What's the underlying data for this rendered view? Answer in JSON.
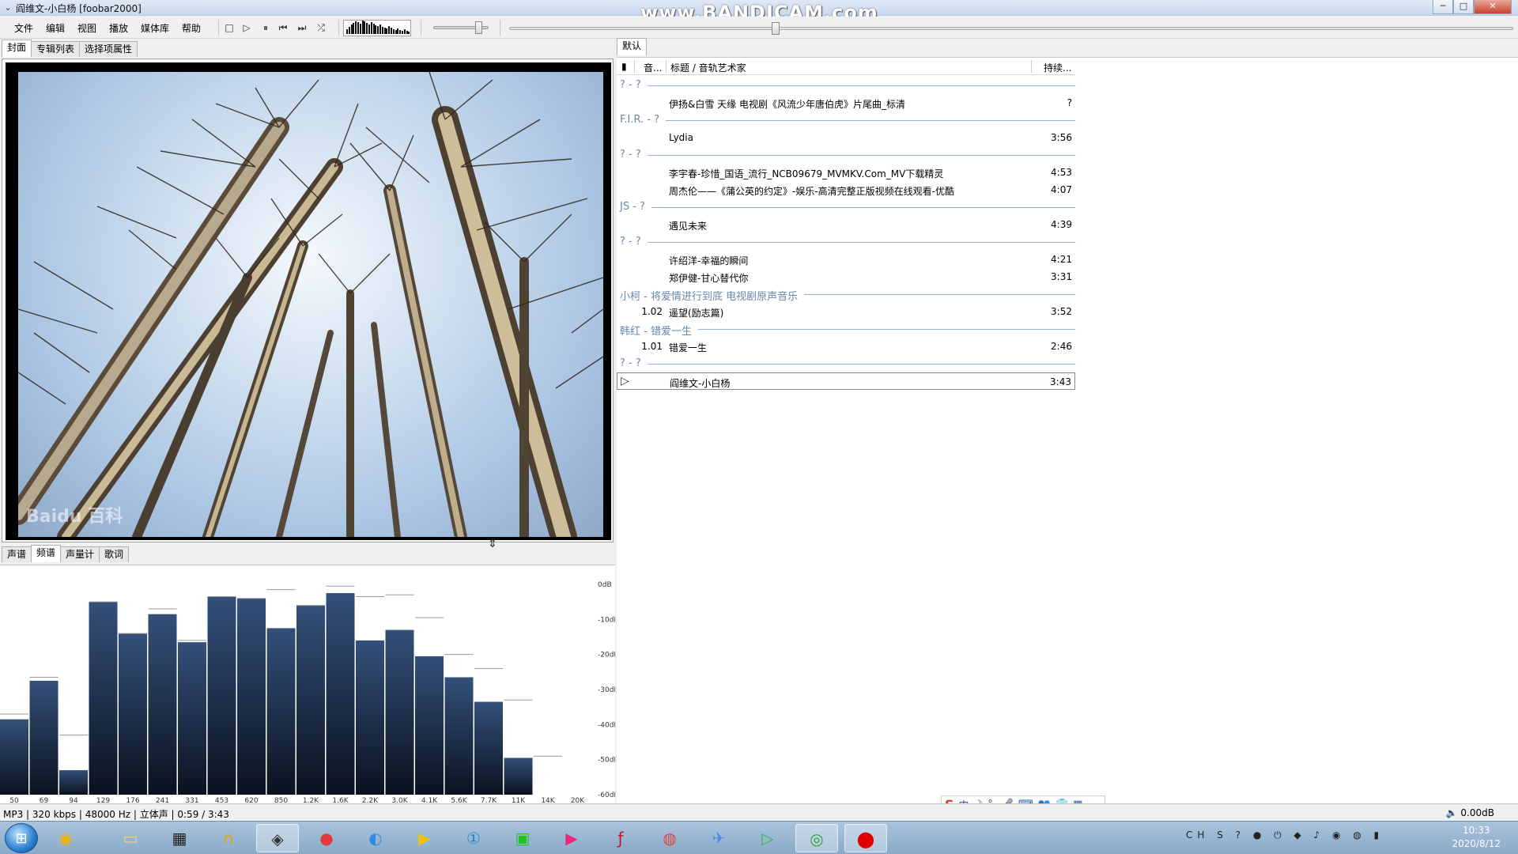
{
  "window": {
    "title": "阎维文-小白杨  [foobar2000]",
    "watermark": "www.BANDICAM.com",
    "minimize_label": "─",
    "maximize_label": "□",
    "close_label": "✕"
  },
  "menu": {
    "items": [
      "文件",
      "编辑",
      "视图",
      "播放",
      "媒体库",
      "帮助"
    ]
  },
  "toolbar": {
    "stop_icon": "stop-icon",
    "play_icon": "play-icon",
    "pause_icon": "pause-icon",
    "prev_icon": "previous-icon",
    "next_icon": "next-icon",
    "random_icon": "random-icon",
    "volume_level": 0.82,
    "seek_position": 0.265
  },
  "left_tabs": [
    {
      "label": "封面",
      "active": true
    },
    {
      "label": "专辑列表",
      "active": false
    },
    {
      "label": "选择项属性",
      "active": false
    }
  ],
  "cover": {
    "watermark": "Baidu 百科"
  },
  "bottom_tabs": [
    {
      "label": "声谱",
      "active": false
    },
    {
      "label": "频谱",
      "active": true
    },
    {
      "label": "声量计",
      "active": false
    },
    {
      "label": "歌词",
      "active": false
    }
  ],
  "chart_data": {
    "type": "bar",
    "categories": [
      "50",
      "69",
      "94",
      "129",
      "176",
      "241",
      "331",
      "453",
      "620",
      "850",
      "1.2K",
      "1.6K",
      "2.2K",
      "3.0K",
      "4.1K",
      "5.6K",
      "7.7K",
      "11K",
      "14K",
      "20K"
    ],
    "values": [
      -38.5,
      -27.5,
      -53,
      -5,
      -14,
      -8.5,
      -16.5,
      -3.5,
      -4,
      -12.5,
      -6,
      -2.5,
      -16,
      -13,
      -20.5,
      -26.5,
      -33.5,
      -49.5,
      -60,
      -60
    ],
    "peaks": [
      -37,
      -26.5,
      -43,
      -5,
      -14,
      -7,
      -16,
      -3.5,
      -4,
      -1.5,
      -6,
      -0.5,
      -3.5,
      -3,
      -9.5,
      -20,
      -24,
      -33,
      -49,
      -60
    ],
    "yticks": [
      "0dB",
      "-10dB",
      "-20dB",
      "-30dB",
      "-40dB",
      "-50dB",
      "-60dB"
    ],
    "ylim": [
      -60,
      0
    ],
    "grid": false
  },
  "right_tabs": [
    {
      "label": "默认",
      "active": true
    }
  ],
  "playlist": {
    "columns": {
      "playing": "▮",
      "track": "音...",
      "title": "标题 / 音轨艺术家",
      "duration": "持续..."
    },
    "rows": [
      {
        "kind": "group",
        "label": "? - ?"
      },
      {
        "kind": "track",
        "num": "",
        "title": "伊扬&白雪 天缘 电视剧《风流少年唐伯虎》片尾曲_标清",
        "duration": "?"
      },
      {
        "kind": "group",
        "label": "F.I.R. - ?"
      },
      {
        "kind": "track",
        "num": "",
        "title": "Lydia",
        "duration": "3:56"
      },
      {
        "kind": "group",
        "label": "? - ?"
      },
      {
        "kind": "track",
        "num": "",
        "title": "李宇春-珍惜_国语_流行_NCB09679_MVMKV.Com_MV下载精灵",
        "duration": "4:53"
      },
      {
        "kind": "track",
        "num": "",
        "title": "周杰伦——《蒲公英的约定》-娱乐-高清完整正版视频在线观看-优酷",
        "duration": "4:07"
      },
      {
        "kind": "group",
        "label": "JS - ?"
      },
      {
        "kind": "track",
        "num": "",
        "title": "遇见未来",
        "duration": "4:39"
      },
      {
        "kind": "group",
        "label": "? - ?"
      },
      {
        "kind": "track",
        "num": "",
        "title": "许绍洋-幸福的瞬间",
        "duration": "4:21"
      },
      {
        "kind": "track",
        "num": "",
        "title": "郑伊健-甘心替代你",
        "duration": "3:31"
      },
      {
        "kind": "group",
        "label": "小柯 - 将爱情进行到底 电视剧原声音乐"
      },
      {
        "kind": "track",
        "num": "1.02",
        "title": "遥望(励志篇)",
        "duration": "3:52"
      },
      {
        "kind": "group",
        "label": "韩红 - 错爱一生"
      },
      {
        "kind": "track",
        "num": "1.01",
        "title": "错爱一生",
        "duration": "2:46"
      },
      {
        "kind": "group",
        "label": "? - ?"
      },
      {
        "kind": "track",
        "num": "",
        "title": "阎维文-小白杨",
        "duration": "3:43",
        "playing": true
      }
    ]
  },
  "status": {
    "text": "MP3 | 320 kbps | 48000 Hz | 立体声 | 0:59 / 3:43",
    "volume": "0.00dB"
  },
  "ime": {
    "logo": "S",
    "mode": "中"
  },
  "taskbar": {
    "icons": [
      "windows-start-icon",
      "ie-icon",
      "file-explorer-icon",
      "calendar-icon",
      "headphones-icon",
      "alien-icon",
      "netease-music-icon",
      "browser-icon",
      "potplayer-icon",
      "number-one-icon",
      "iqiyi-icon",
      "youku-icon",
      "flash-icon",
      "chrome-icon",
      "bird-icon",
      "play-icon",
      "foobar-icon",
      "record-icon"
    ],
    "clock_time": "10:33",
    "clock_date": "2020/8/12"
  }
}
